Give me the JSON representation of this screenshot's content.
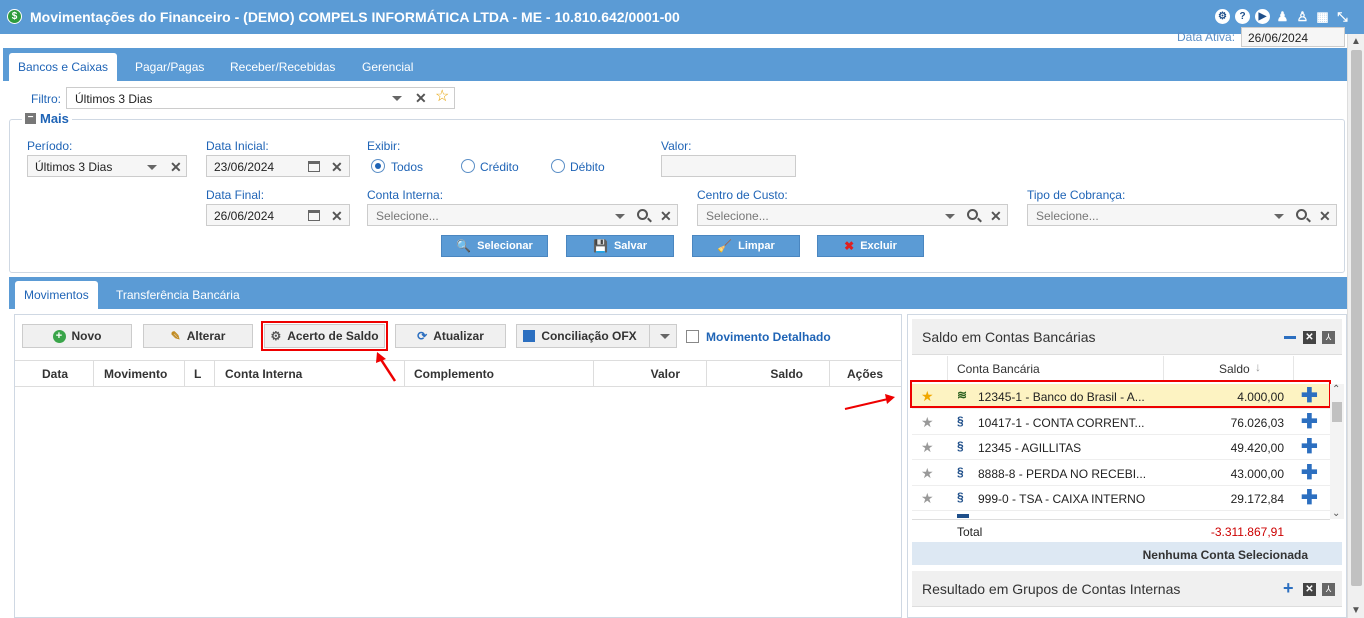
{
  "window": {
    "title": "Movimentações do Financeiro - (DEMO) COMPELS INFORMÁTICA LTDA - ME - 10.810.642/0001-00"
  },
  "header": {
    "data_ativa_label": "Data Ativa:",
    "data_ativa_value": "26/06/2024"
  },
  "tabs": [
    {
      "label": "Bancos e Caixas"
    },
    {
      "label": "Pagar/Pagas"
    },
    {
      "label": "Receber/Recebidas"
    },
    {
      "label": "Gerencial"
    }
  ],
  "filtro": {
    "label": "Filtro:",
    "value": "Últimos 3 Dias"
  },
  "mais": {
    "legend": "Mais",
    "periodo_label": "Período:",
    "periodo_value": "Últimos 3 Dias",
    "data_inicial_label": "Data Inicial:",
    "data_inicial_value": "23/06/2024",
    "data_final_label": "Data Final:",
    "data_final_value": "26/06/2024",
    "exibir_label": "Exibir:",
    "exibir_options": [
      "Todos",
      "Crédito",
      "Débito"
    ],
    "valor_label": "Valor:",
    "conta_interna_label": "Conta Interna:",
    "conta_interna_placeholder": "Selecione...",
    "centro_custo_label": "Centro de Custo:",
    "centro_custo_placeholder": "Selecione...",
    "tipo_cobranca_label": "Tipo de Cobrança:",
    "tipo_cobranca_placeholder": "Selecione...",
    "buttons": {
      "selecionar": "Selecionar",
      "salvar": "Salvar",
      "limpar": "Limpar",
      "excluir": "Excluir"
    }
  },
  "subtabs": [
    {
      "label": "Movimentos"
    },
    {
      "label": "Transferência Bancária"
    }
  ],
  "toolbar": {
    "novo": "Novo",
    "alterar": "Alterar",
    "acerto_saldo": "Acerto de Saldo",
    "atualizar": "Atualizar",
    "conciliacao": "Conciliação OFX",
    "movimento_detalhado": "Movimento Detalhado"
  },
  "grid": {
    "columns": [
      "Data",
      "Movimento",
      "L",
      "Conta Interna",
      "Complemento",
      "Valor",
      "Saldo",
      "Ações"
    ]
  },
  "saldo_panel": {
    "title": "Saldo em Contas Bancárias",
    "col_conta": "Conta Bancária",
    "col_saldo": "Saldo",
    "accounts": [
      {
        "name": "12345-1 - Banco do Brasil - A...",
        "saldo": "4.000,00"
      },
      {
        "name": "10417-1 - CONTA CORRENT...",
        "saldo": "76.026,03"
      },
      {
        "name": "12345 - AGILLITAS",
        "saldo": "49.420,00"
      },
      {
        "name": "8888-8 - PERDA NO RECEBI...",
        "saldo": "43.000,00"
      },
      {
        "name": "999-0 - TSA - CAIXA INTERNO",
        "saldo": "29.172,84"
      }
    ],
    "total_label": "Total",
    "total_value": "-3.311.867,91",
    "footer": "Nenhuma Conta Selecionada"
  },
  "resultado_panel": {
    "title": "Resultado em Grupos de Contas Internas"
  },
  "colors": {
    "accent": "#5b9bd5",
    "link": "#1f64b6",
    "highlight_border": "#e00000",
    "negative": "#cc0000",
    "selected_row": "#fdf3c2"
  }
}
